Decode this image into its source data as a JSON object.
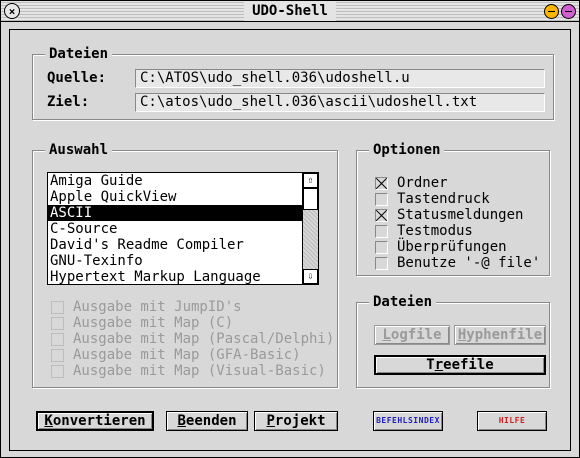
{
  "window": {
    "title": "UDO-Shell"
  },
  "dateien_top": {
    "label": "Dateien",
    "quelle_label": "Quelle:",
    "quelle_value": "C:\\ATOS\\udo_shell.036\\udoshell.u",
    "ziel_label": "Ziel:",
    "ziel_value": "C:\\atos\\udo_shell.036\\ascii\\udoshell.txt"
  },
  "auswahl": {
    "label": "Auswahl",
    "items": [
      "Amiga Guide",
      "Apple QuickView",
      "ASCII",
      "C-Source",
      "David's Readme Compiler",
      "GNU-Texinfo",
      "Hypertext Markup Language"
    ],
    "selected_index": 2,
    "scroll_up": "⇧",
    "scroll_down": "⇩",
    "map_options": [
      "Ausgabe mit JumpID's",
      "Ausgabe mit Map (C)",
      "Ausgabe mit Map (Pascal/Delphi)",
      "Ausgabe mit Map (GFA-Basic)",
      "Ausgabe mit Map (Visual-Basic)"
    ]
  },
  "optionen": {
    "label": "Optionen",
    "items": [
      {
        "label": "Ordner",
        "checked": true
      },
      {
        "label": "Tastendruck",
        "checked": false
      },
      {
        "label": "Statusmeldungen",
        "checked": true
      },
      {
        "label": "Testmodus",
        "checked": false
      },
      {
        "label": "Überprüfungen",
        "checked": false
      },
      {
        "label": "Benutze '-@ file'",
        "checked": false
      }
    ]
  },
  "dateien_right": {
    "label": "Dateien",
    "logfile": "Logfile",
    "hyphenfile": "Hyphenfile",
    "treefile": "Treefile"
  },
  "buttons": {
    "konvertieren": "Konvertieren",
    "beenden": "Beenden",
    "projekt": "Projekt",
    "befehlsindex": "BEFEHLSINDEX",
    "hilfe": "HILFE"
  },
  "colors": {
    "window_bg": "#d8d8d8",
    "minimize": "#ffb400",
    "maximize": "#d060d0",
    "befehlsindex_text": "#2020c0",
    "hilfe_text": "#d02020"
  }
}
